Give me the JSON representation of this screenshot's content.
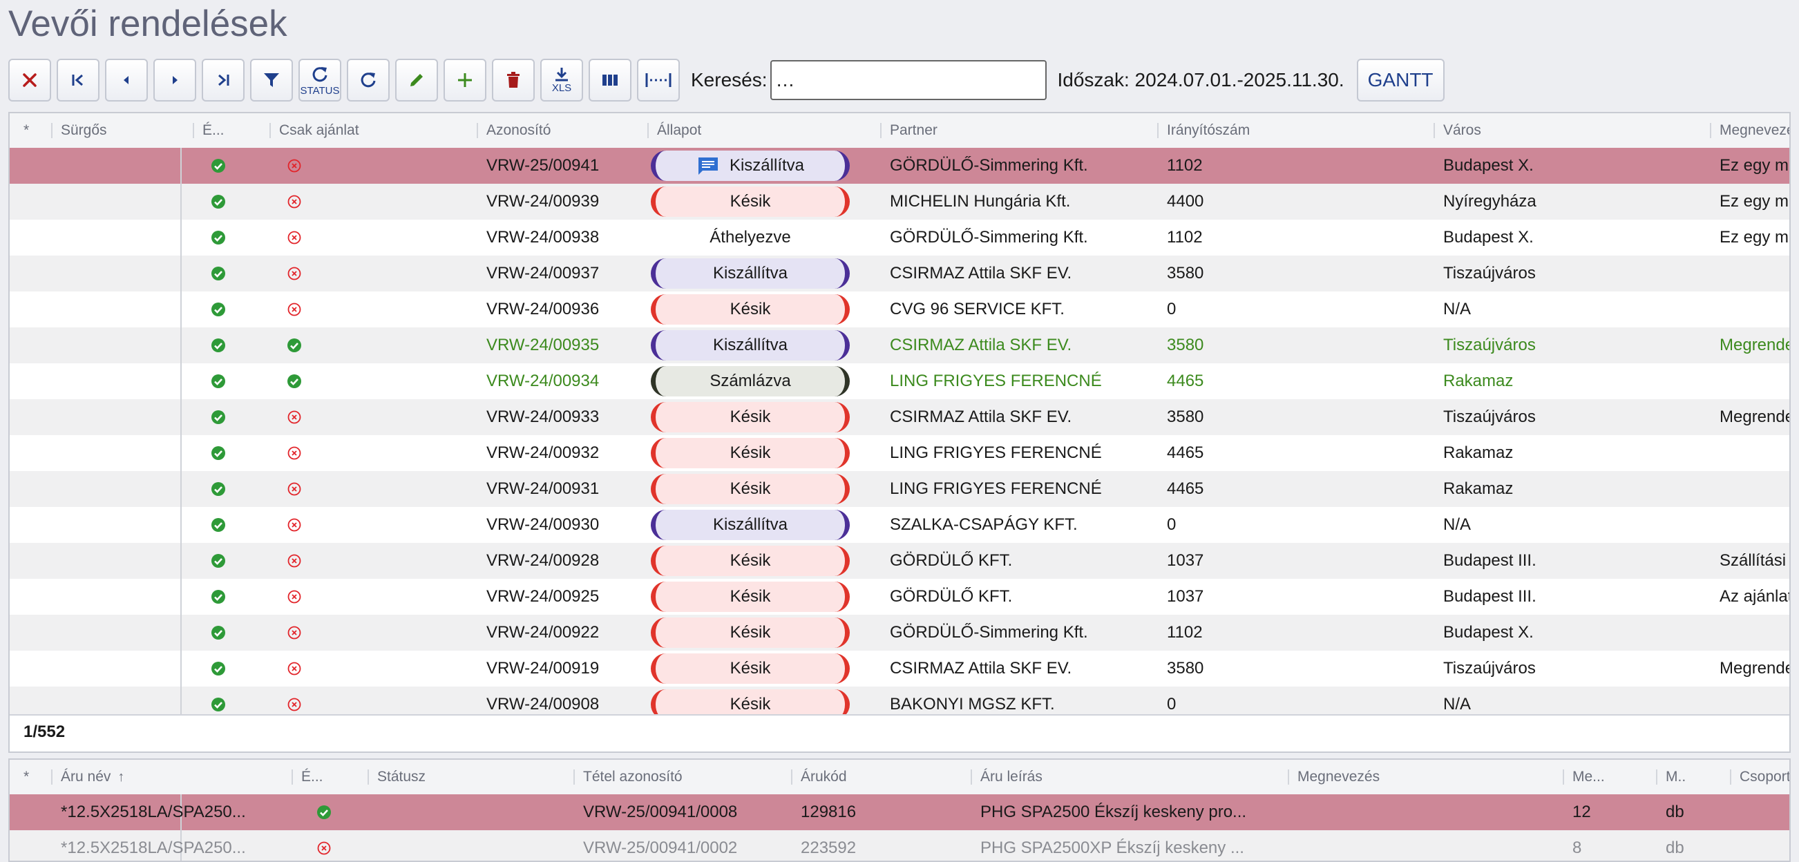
{
  "page_title": "Vevői rendelések",
  "toolbar": {
    "buttons": [
      {
        "name": "close-button",
        "icon": "close-icon"
      },
      {
        "name": "first-record-button",
        "icon": "first-icon"
      },
      {
        "name": "previous-record-button",
        "icon": "prev-icon"
      },
      {
        "name": "next-record-button",
        "icon": "next-icon"
      },
      {
        "name": "last-record-button",
        "icon": "last-icon"
      },
      {
        "name": "filter-button",
        "icon": "filter-icon"
      },
      {
        "name": "status-refresh-button",
        "icon": "refresh-icon",
        "caption": "STATUS"
      },
      {
        "name": "refresh-button",
        "icon": "refresh-icon"
      },
      {
        "name": "edit-button",
        "icon": "pencil-icon"
      },
      {
        "name": "add-button",
        "icon": "plus-icon"
      },
      {
        "name": "delete-button",
        "icon": "trash-icon"
      },
      {
        "name": "export-xls-button",
        "icon": "download-icon",
        "caption": "XLS"
      },
      {
        "name": "columns-button",
        "icon": "columns-icon"
      },
      {
        "name": "column-width-button",
        "icon": "width-icon"
      }
    ],
    "search_label": "Keresés:",
    "search_value": "…",
    "period": "Időszak: 2024.07.01.-2025.11.30.",
    "gantt_label": "GANTT"
  },
  "colors": {
    "accent": "#1f3f8c",
    "selected_row": "#cd8797",
    "green_text": "#3c8a1e",
    "check_green": "#2e9a38",
    "cross_red": "#e2242a",
    "kesik_border": "#e0342b",
    "kesik_fill": "#fde4e4",
    "kiszallitva_border": "#4b2f97",
    "kiszallitva_fill": "#e5e3f4",
    "szamlazva_border": "#2f3427",
    "szamlazva_fill": "#e7e9e3"
  },
  "orders": {
    "columns": [
      "*",
      "Sürgős",
      "É...",
      "Csak ajánlat",
      "Azonosító",
      "Állapot",
      "Partner",
      "Irányítószám",
      "Város",
      "Megnevezés"
    ],
    "rows": [
      {
        "e": "check",
        "csak": "cross",
        "id": "VRW-25/00941",
        "status": "Kiszállítva",
        "status_type": "kiszallitva",
        "chat": true,
        "partner": "GÖRDÜLŐ-Simmering Kft.",
        "zip": "1102",
        "city": "Budapest X.",
        "name": "Ez egy megjegyzés",
        "style": "sel"
      },
      {
        "e": "check",
        "csak": "cross",
        "id": "VRW-24/00939",
        "status": "Késik",
        "status_type": "kesik",
        "partner": "MICHELIN Hungária Kft.",
        "zip": "4400",
        "city": "Nyíregyháza",
        "name": "Ez egy megjegyzés",
        "style": "alt"
      },
      {
        "e": "check",
        "csak": "cross",
        "id": "VRW-24/00938",
        "status": "Áthelyezve",
        "status_type": "plain",
        "partner": "GÖRDÜLŐ-Simmering Kft.",
        "zip": "1102",
        "city": "Budapest X.",
        "name": "Ez egy megjegyzés",
        "style": "white"
      },
      {
        "e": "check",
        "csak": "cross",
        "id": "VRW-24/00937",
        "status": "Kiszállítva",
        "status_type": "kiszallitva",
        "partner": "CSIRMAZ Attila SKF EV.",
        "zip": "3580",
        "city": "Tiszaújváros",
        "name": "",
        "style": "alt"
      },
      {
        "e": "check",
        "csak": "cross",
        "id": "VRW-24/00936",
        "status": "Késik",
        "status_type": "kesik",
        "partner": "CVG 96 SERVICE KFT.",
        "zip": "0",
        "city": "N/A",
        "name": "",
        "style": "white"
      },
      {
        "e": "check",
        "csak": "check",
        "id": "VRW-24/00935",
        "status": "Kiszállítva",
        "status_type": "kiszallitva",
        "partner": "CSIRMAZ Attila SKF EV.",
        "zip": "3580",
        "city": "Tiszaújváros",
        "name": "Megrendelés",
        "style": "alt green"
      },
      {
        "e": "check",
        "csak": "check",
        "id": "VRW-24/00934",
        "status": "Számlázva",
        "status_type": "szamlazva",
        "partner": "LING FRIGYES FERENCNÉ",
        "zip": "4465",
        "city": "Rakamaz",
        "name": "",
        "style": "white green"
      },
      {
        "e": "check",
        "csak": "cross",
        "id": "VRW-24/00933",
        "status": "Késik",
        "status_type": "kesik",
        "partner": "CSIRMAZ Attila SKF EV.",
        "zip": "3580",
        "city": "Tiszaújváros",
        "name": "Megrendelés",
        "style": "alt"
      },
      {
        "e": "check",
        "csak": "cross",
        "id": "VRW-24/00932",
        "status": "Késik",
        "status_type": "kesik",
        "partner": "LING FRIGYES FERENCNÉ",
        "zip": "4465",
        "city": "Rakamaz",
        "name": "",
        "style": "white"
      },
      {
        "e": "check",
        "csak": "cross",
        "id": "VRW-24/00931",
        "status": "Késik",
        "status_type": "kesik",
        "partner": "LING FRIGYES FERENCNÉ",
        "zip": "4465",
        "city": "Rakamaz",
        "name": "",
        "style": "alt"
      },
      {
        "e": "check",
        "csak": "cross",
        "id": "VRW-24/00930",
        "status": "Kiszállítva",
        "status_type": "kiszallitva",
        "partner": "SZALKA-CSAPÁGY KFT.",
        "zip": "0",
        "city": "N/A",
        "name": "",
        "style": "white"
      },
      {
        "e": "check",
        "csak": "cross",
        "id": "VRW-24/00928",
        "status": "Késik",
        "status_type": "kesik",
        "partner": "GÖRDÜLŐ KFT.",
        "zip": "1037",
        "city": "Budapest III.",
        "name": "Szállítási cím",
        "style": "alt"
      },
      {
        "e": "check",
        "csak": "cross",
        "id": "VRW-24/00925",
        "status": "Késik",
        "status_type": "kesik",
        "partner": "GÖRDÜLŐ KFT.",
        "zip": "1037",
        "city": "Budapest III.",
        "name": "Az ajánlat",
        "style": "white"
      },
      {
        "e": "check",
        "csak": "cross",
        "id": "VRW-24/00922",
        "status": "Késik",
        "status_type": "kesik",
        "partner": "GÖRDÜLŐ-Simmering Kft.",
        "zip": "1102",
        "city": "Budapest X.",
        "name": "",
        "style": "alt"
      },
      {
        "e": "check",
        "csak": "cross",
        "id": "VRW-24/00919",
        "status": "Késik",
        "status_type": "kesik",
        "partner": "CSIRMAZ Attila SKF EV.",
        "zip": "3580",
        "city": "Tiszaújváros",
        "name": "Megrendelés",
        "style": "white"
      },
      {
        "e": "check",
        "csak": "cross",
        "id": "VRW-24/00908",
        "status": "Késik",
        "status_type": "kesik",
        "partner": "BAKONYI MGSZ KFT.",
        "zip": "0",
        "city": "N/A",
        "name": "",
        "style": "alt"
      }
    ],
    "record_counter": "1/552"
  },
  "items": {
    "columns": [
      "*",
      "Áru név",
      "É...",
      "Státusz",
      "Tétel azonosító",
      "Árukód",
      "Áru leírás",
      "Megnevezés",
      "Me...",
      "M..",
      "Csoport"
    ],
    "sort_indicator": "↑",
    "rows": [
      {
        "name": "*12.5X2518LA/SPA250...",
        "e": "check",
        "statusz": "",
        "tetel": "VRW-25/00941/0008",
        "kod": "129816",
        "leiras": "PHG SPA2500 Ékszíj keskeny pro...",
        "megnev": "",
        "me": "12",
        "m": "db",
        "style": "sel"
      },
      {
        "name": "*12.5X2518LA/SPA250...",
        "e": "cross",
        "statusz": "",
        "tetel": "VRW-25/00941/0002",
        "kod": "223592",
        "leiras": "PHG SPA2500XP Ékszíj keskeny ...",
        "megnev": "",
        "me": "8",
        "m": "db",
        "style": "alt grey"
      }
    ]
  }
}
